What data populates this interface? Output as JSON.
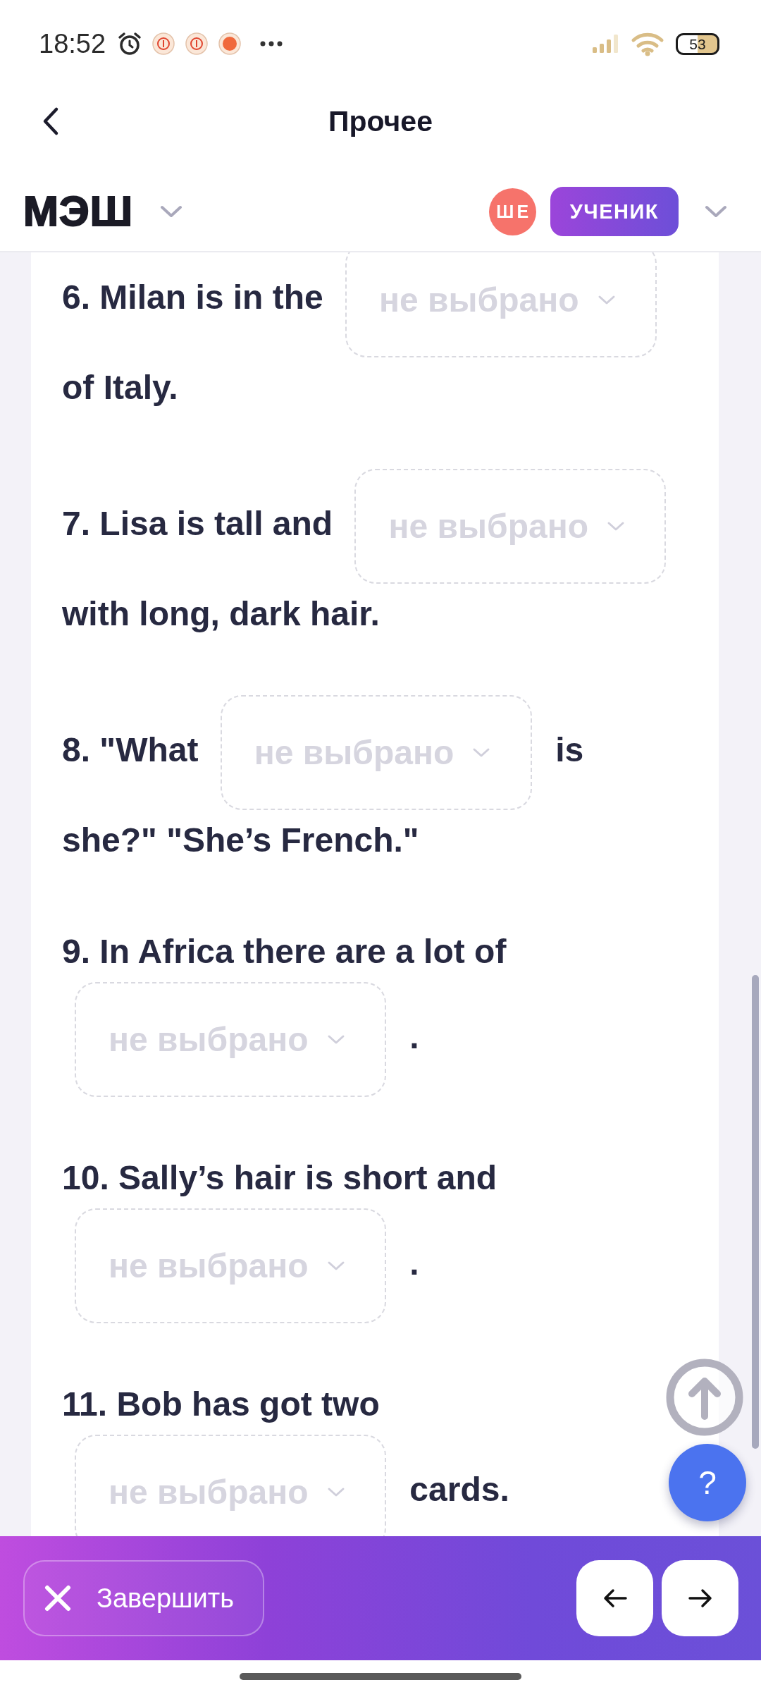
{
  "status_bar": {
    "time": "18:52",
    "battery": "53"
  },
  "header": {
    "title": "Прочее"
  },
  "top_bar": {
    "logo": "МЭШ",
    "avatar": "ШЕ",
    "role": "УЧЕНИК"
  },
  "questions": [
    {
      "parts": [
        {
          "kind": "text",
          "text": "6. Milan is in the"
        },
        {
          "kind": "select",
          "placeholder": "не выбрано"
        },
        {
          "kind": "text",
          "text": "of Italy."
        }
      ]
    },
    {
      "parts": [
        {
          "kind": "text",
          "text": "7. Lisa is tall and"
        },
        {
          "kind": "select",
          "placeholder": "не выбрано"
        },
        {
          "kind": "text",
          "text": "with long, dark hair."
        }
      ]
    },
    {
      "parts": [
        {
          "kind": "text",
          "text": "8. \"What"
        },
        {
          "kind": "select",
          "placeholder": "не выбрано"
        },
        {
          "kind": "text",
          "text": "is"
        },
        {
          "kind": "text",
          "text": "she?\" \"She’s French.\""
        }
      ]
    },
    {
      "parts": [
        {
          "kind": "text",
          "text": "9. In Africa there are a lot of"
        },
        {
          "kind": "select",
          "placeholder": "не выбрано"
        },
        {
          "kind": "text",
          "text": "."
        }
      ]
    },
    {
      "parts": [
        {
          "kind": "text",
          "text": "10. Sally’s hair is short and"
        },
        {
          "kind": "select",
          "placeholder": "не выбрано"
        },
        {
          "kind": "text",
          "text": "."
        }
      ]
    },
    {
      "parts": [
        {
          "kind": "text",
          "text": "11. Bob has got two"
        },
        {
          "kind": "select",
          "placeholder": "не выбрано"
        },
        {
          "kind": "text",
          "text": "cards."
        }
      ]
    }
  ],
  "help_button": {
    "label": "?"
  },
  "footer": {
    "finish_button": "Завершить"
  }
}
